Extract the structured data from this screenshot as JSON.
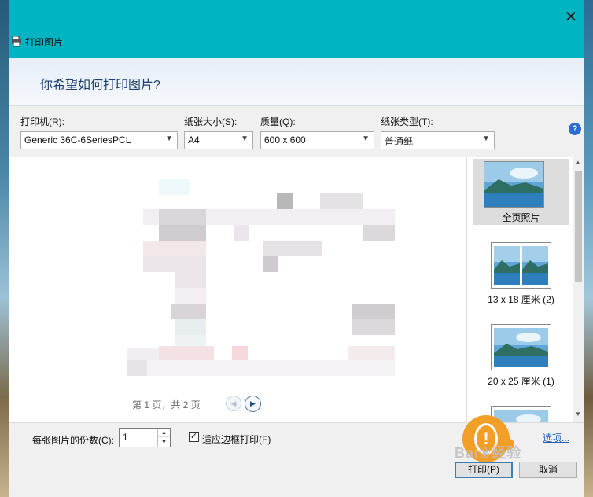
{
  "window": {
    "title": "打印图片",
    "close": "✕"
  },
  "header": {
    "question": "你希望如何打印图片?"
  },
  "toolbar": {
    "printer": {
      "label": "打印机(R):",
      "value": "Generic 36C-6SeriesPCL"
    },
    "paper_size": {
      "label": "纸张大小(S):",
      "value": "A4"
    },
    "quality": {
      "label": "质量(Q):",
      "value": "600 x 600"
    },
    "paper_type": {
      "label": "纸张类型(T):",
      "value": "普通纸"
    },
    "help": "?"
  },
  "preview": {
    "page_info": "第 1 页，共 2 页",
    "prev": "◀",
    "next": "▶"
  },
  "layouts": [
    {
      "caption": "全页照片",
      "selected": true
    },
    {
      "caption": "13 x 18 厘米 (2)",
      "selected": false
    },
    {
      "caption": "20 x 25 厘米 (1)",
      "selected": false
    }
  ],
  "scrollbar": {
    "up": "▲",
    "down": "▼"
  },
  "options": {
    "copies_label": "每张图片的份数(C):",
    "copies_value": "1",
    "spin_up": "▲",
    "spin_down": "▼",
    "fit_label": "适应边框打印(F)",
    "fit_checked": "✓",
    "options_link": "选项..."
  },
  "buttons": {
    "print": "打印(P)",
    "cancel": "取消"
  },
  "watermark": {
    "text": "Bai❀经验",
    "mark": "!"
  },
  "colors": {
    "titlebar": "#00b4c2",
    "header_text": "#1f3f6e",
    "link": "#1f5fb4"
  }
}
